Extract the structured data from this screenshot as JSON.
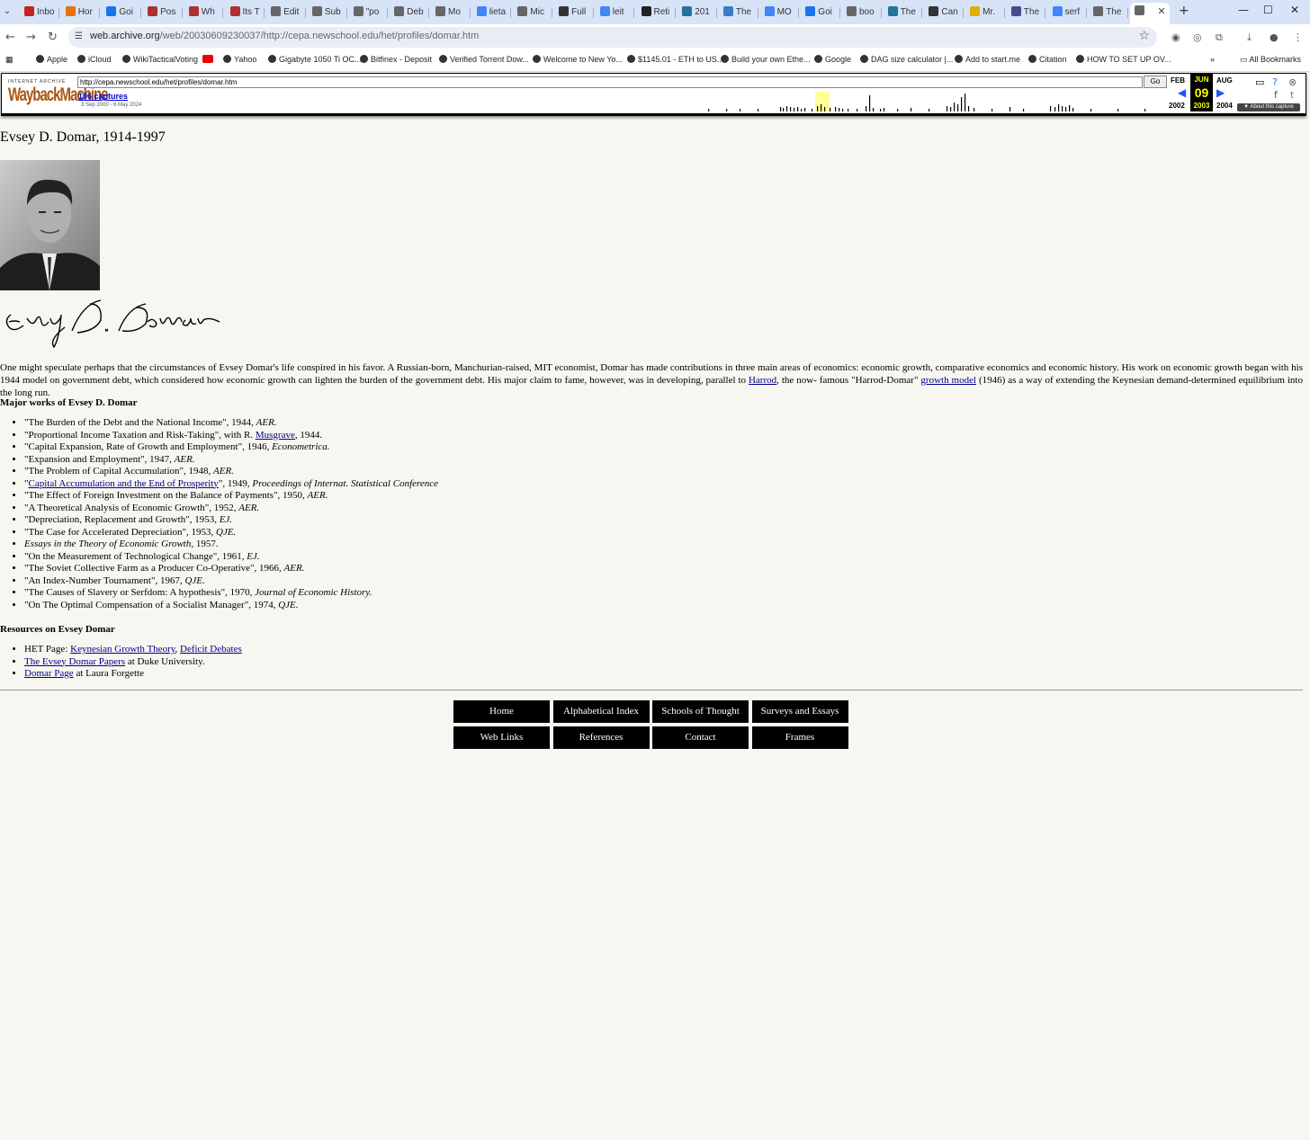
{
  "browser": {
    "tabs": [
      {
        "label": "Inbo",
        "color": "#c5221f"
      },
      {
        "label": "Hor",
        "color": "#e8710a"
      },
      {
        "label": "Goi",
        "color": "#1a73e8"
      },
      {
        "label": "Pos",
        "color": "#b03030"
      },
      {
        "label": "Wh",
        "color": "#b03030"
      },
      {
        "label": "Its T",
        "color": "#b03030"
      },
      {
        "label": "Edit",
        "color": "#666666"
      },
      {
        "label": "Sub",
        "color": "#666666"
      },
      {
        "label": "\"po",
        "color": "#666666"
      },
      {
        "label": "Deb",
        "color": "#666666"
      },
      {
        "label": "Mo",
        "color": "#666666"
      },
      {
        "label": "lieta",
        "color": "#4285f4"
      },
      {
        "label": "Mic",
        "color": "#666666"
      },
      {
        "label": "Full",
        "color": "#333333"
      },
      {
        "label": "leit",
        "color": "#4285f4"
      },
      {
        "label": "Reti",
        "color": "#222222"
      },
      {
        "label": "201",
        "color": "#21759b"
      },
      {
        "label": "The",
        "color": "#3b7ac9"
      },
      {
        "label": "MO",
        "color": "#4285f4"
      },
      {
        "label": "Goi",
        "color": "#1a73e8"
      },
      {
        "label": "boo",
        "color": "#666666"
      },
      {
        "label": "The",
        "color": "#21759b"
      },
      {
        "label": "Can",
        "color": "#333333"
      },
      {
        "label": "Mr.",
        "color": "#e0b000"
      },
      {
        "label": "The",
        "color": "#4a4a8a"
      },
      {
        "label": "serf",
        "color": "#4285f4"
      },
      {
        "label": "The",
        "color": "#666666"
      },
      {
        "label": "",
        "color": "#666666"
      }
    ],
    "new_tab_label": "+",
    "minimize": "—",
    "maximize": "☐",
    "close": "✕",
    "omnibox": {
      "host": "web.archive.org",
      "path": "/web/20030609230037/http://cepa.newschool.edu/het/profiles/domar.htm"
    },
    "bookmarks": [
      {
        "label": "Apple"
      },
      {
        "label": "iCloud"
      },
      {
        "label": "WikiTacticalVoting"
      },
      {
        "label": ""
      },
      {
        "label": "Yahoo"
      },
      {
        "label": "Gigabyte 1050 Ti OC..."
      },
      {
        "label": "Bitfinex - Deposit"
      },
      {
        "label": "Verified Torrent Dow..."
      },
      {
        "label": "Welcome to New Yo..."
      },
      {
        "label": "$1145.01 - ETH to US..."
      },
      {
        "label": "Build your own Ethe..."
      },
      {
        "label": "Google"
      },
      {
        "label": "DAG size calculator |..."
      },
      {
        "label": "Add to start.me"
      },
      {
        "label": "Citation"
      },
      {
        "label": "HOW TO SET UP OV..."
      }
    ],
    "bookmarks_more": "»",
    "all_bookmarks": "All Bookmarks"
  },
  "wayback": {
    "logo_top": "INTERNET ARCHIVE",
    "logo": "WaybackMachine",
    "url": "http://cepa.newschool.edu/het/profiles/domar.htm",
    "go": "Go",
    "captures": "106 captures",
    "range": "3 Sep 2000 - 6 May 2024",
    "prev_month": "FEB",
    "prev_year": "2002",
    "cur_month": "JUN",
    "cur_day": "09",
    "cur_year": "2003",
    "next_month": "AUG",
    "next_year": "2004",
    "about": "▼ About this capture"
  },
  "page": {
    "title": "Evsey D. Domar, 1914-1997",
    "intro_1": "One might speculate perhaps that the circumstances of Evsey Domar's life conspired in his favor. A Russian-born, Manchurian-raised, MIT economist, Domar has made contributions in three main areas of economics: economic growth, comparative economics and economic history. His work on economic growth began with his 1944 model on government debt, which considered how economic growth can lighten the burden of the government debt. His major claim to fame, however, was in developing, parallel to ",
    "intro_link_1": "Harrod",
    "intro_2": ", the now- famous \"Harrod-Domar\" ",
    "intro_link_2": "growth model",
    "intro_3": " (1946) as a way of extending the Keynesian demand-determined equilibrium into the long run.",
    "works_heading": "Major works of Evsey D. Domar",
    "works": [
      {
        "pre": "\"The Burden of the Debt and the National Income\", 1944, ",
        "link": "",
        "mid": "",
        "journal": "AER."
      },
      {
        "pre": "\"Proportional Income Taxation and Risk-Taking\", with R. ",
        "link": "Musgrave",
        "mid": ", 1944.",
        "journal": ""
      },
      {
        "pre": "\"Capital Expansion, Rate of Growth and Employment\", 1946, ",
        "link": "",
        "mid": "",
        "journal": "Econometrica."
      },
      {
        "pre": "\"Expansion and Employment\", 1947, ",
        "link": "",
        "mid": "",
        "journal": "AER."
      },
      {
        "pre": "\"The Problem of Capital Accumulation\", 1948, ",
        "link": "",
        "mid": "",
        "journal": "AER."
      },
      {
        "pre": "\"",
        "link": "Capital Accumulation and the End of Prosperity",
        "mid": "\", 1949, ",
        "journal": "Proceedings of Internat. Statistical Conference"
      },
      {
        "pre": "\"The Effect of Foreign Investment on the Balance of Payments\", 1950, ",
        "link": "",
        "mid": "",
        "journal": "AER."
      },
      {
        "pre": "\"A Theoretical Analysis of Economic Growth\", 1952, ",
        "link": "",
        "mid": "",
        "journal": "AER."
      },
      {
        "pre": "\"Depreciation, Replacement and Growth\", 1953, ",
        "link": "",
        "mid": "",
        "journal": "EJ."
      },
      {
        "pre": "\"The Case for Accelerated Depreciation\", 1953, ",
        "link": "",
        "mid": "",
        "journal": "QJE."
      },
      {
        "pre": "",
        "link": "",
        "mid": "",
        "journal": "Essays in the Theory of Economic Growth",
        "post": ", 1957."
      },
      {
        "pre": "\"On the Measurement of Technological Change\", 1961, ",
        "link": "",
        "mid": "",
        "journal": "EJ."
      },
      {
        "pre": "\"The Soviet Collective Farm as a Producer Co-Operative\", 1966, ",
        "link": "",
        "mid": "",
        "journal": "AER."
      },
      {
        "pre": "\"An Index-Number Tournament\", 1967, ",
        "link": "",
        "mid": "",
        "journal": "QJE."
      },
      {
        "pre": "\"The Causes of Slavery or Serfdom: A hypothesis\", 1970, ",
        "link": "",
        "mid": "",
        "journal": "Journal of Economic History."
      },
      {
        "pre": "\"On The Optimal Compensation of a Socialist Manager\", 1974, ",
        "link": "",
        "mid": "",
        "journal": "QJE."
      }
    ],
    "resources_heading": "Resources on Evsey Domar",
    "resources": [
      {
        "pre": "HET Page: ",
        "link1": "Keynesian Growth Theory",
        "sep": ", ",
        "link2": "Deficit Debates",
        "post": ""
      },
      {
        "pre": "",
        "link1": "The Evsey Domar Papers",
        "sep": "",
        "link2": "",
        "post": " at Duke University."
      },
      {
        "pre": "",
        "link1": "Domar Page",
        "sep": "",
        "link2": "",
        "post": " at Laura Forgette"
      }
    ],
    "nav_buttons": [
      "Home",
      "Alphabetical Index",
      "Schools of Thought",
      "Surveys and Essays",
      "Web Links",
      "References",
      "Contact",
      "Frames"
    ]
  }
}
